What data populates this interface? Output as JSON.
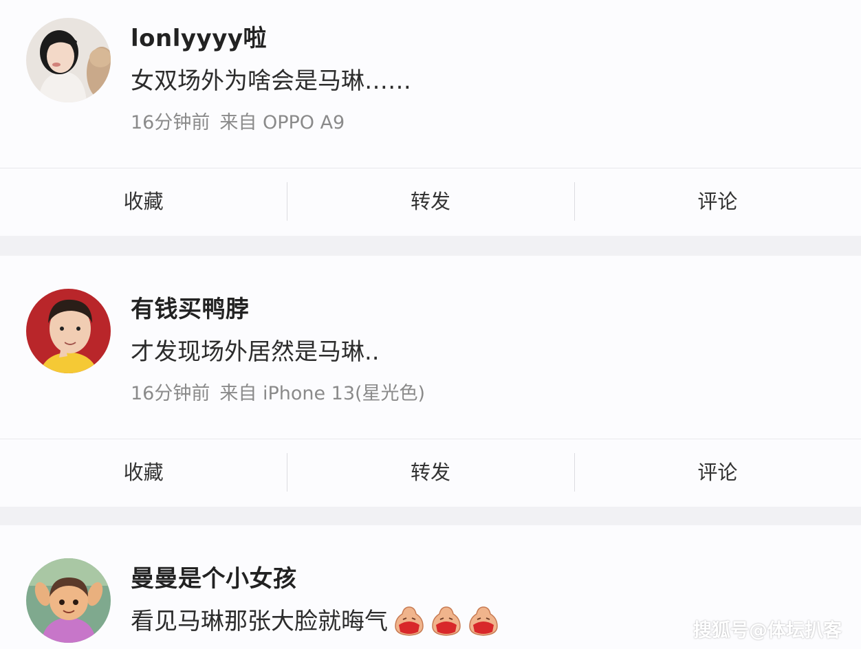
{
  "posts": [
    {
      "username": "lonlyyyy啦",
      "content": "女双场外为啥会是马琳……",
      "time": "16分钟前",
      "source": "来自 OPPO A9",
      "actions": {
        "collect": "收藏",
        "repost": "转发",
        "comment": "评论"
      }
    },
    {
      "username": "有钱买鸭脖",
      "content": "才发现场外居然是马琳..",
      "time": "16分钟前",
      "source": "来自 iPhone 13(星光色)",
      "actions": {
        "collect": "收藏",
        "repost": "转发",
        "comment": "评论"
      }
    },
    {
      "username": "曼曼是个小女孩",
      "content": "看见马琳那张大脸就晦气",
      "emoji_count": 3
    }
  ],
  "watermark": "搜狐号@体坛扒客",
  "colors": {
    "card_bg": "#fcfcfe",
    "divider_bg": "#f1f1f4",
    "username": "#222222",
    "meta": "#8a8a8a",
    "emoji_face": "#f0b48c",
    "emoji_mouth": "#d8282a"
  }
}
